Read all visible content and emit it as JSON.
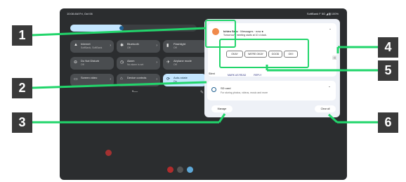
{
  "status_bar": {
    "left": "10:08 AM Fri, Oct 06",
    "right": "SoftBank F 5G ◢ ▮ 100%"
  },
  "quick_settings": {
    "tiles": [
      {
        "label": "Internet",
        "sub": "SoftBank, SoftBank",
        "icon": "wifi-icon",
        "active": false
      },
      {
        "label": "Bluetooth",
        "sub": "Off",
        "icon": "bluetooth-icon",
        "active": false
      },
      {
        "label": "Flashlight",
        "sub": "Off",
        "icon": "flashlight-icon",
        "active": false
      },
      {
        "label": "Do Not Disturb",
        "sub": "Off",
        "icon": "dnd-icon",
        "active": false
      },
      {
        "label": "Alarm",
        "sub": "No alarm is set",
        "icon": "alarm-icon",
        "active": false
      },
      {
        "label": "Airplane mode",
        "sub": "Off",
        "icon": "airplane-icon",
        "active": false
      },
      {
        "label": "Screen video",
        "sub": "",
        "icon": "screen-video-icon",
        "active": false
      },
      {
        "label": "Device controls",
        "sub": "",
        "icon": "home-icon",
        "active": false
      },
      {
        "label": "Auto-rotate",
        "sub": "On",
        "icon": "rotate-icon",
        "active": true
      }
    ]
  },
  "notification": {
    "sender": "Ichiro Sato",
    "meta": "· Messages · now ●",
    "message": "Tomorrow's meeting starts at 10 o'clock.",
    "smart_replies": [
      "OKAY",
      "WE’RE OKAY",
      "GOOD",
      "OK!!"
    ],
    "actions": [
      "MARK AS READ",
      "REPLY"
    ]
  },
  "silent_section": {
    "header": "Silent",
    "sd_card": {
      "title": "SD card",
      "subtitle": "For storing photos, videos, music and more"
    }
  },
  "buttons": {
    "manage": "Manage",
    "clear_all": "Clear all"
  },
  "callouts": [
    "1",
    "2",
    "3",
    "4",
    "5",
    "6"
  ],
  "colors": {
    "highlight": "#22d56b",
    "active_tile": "#c4e6ff"
  }
}
